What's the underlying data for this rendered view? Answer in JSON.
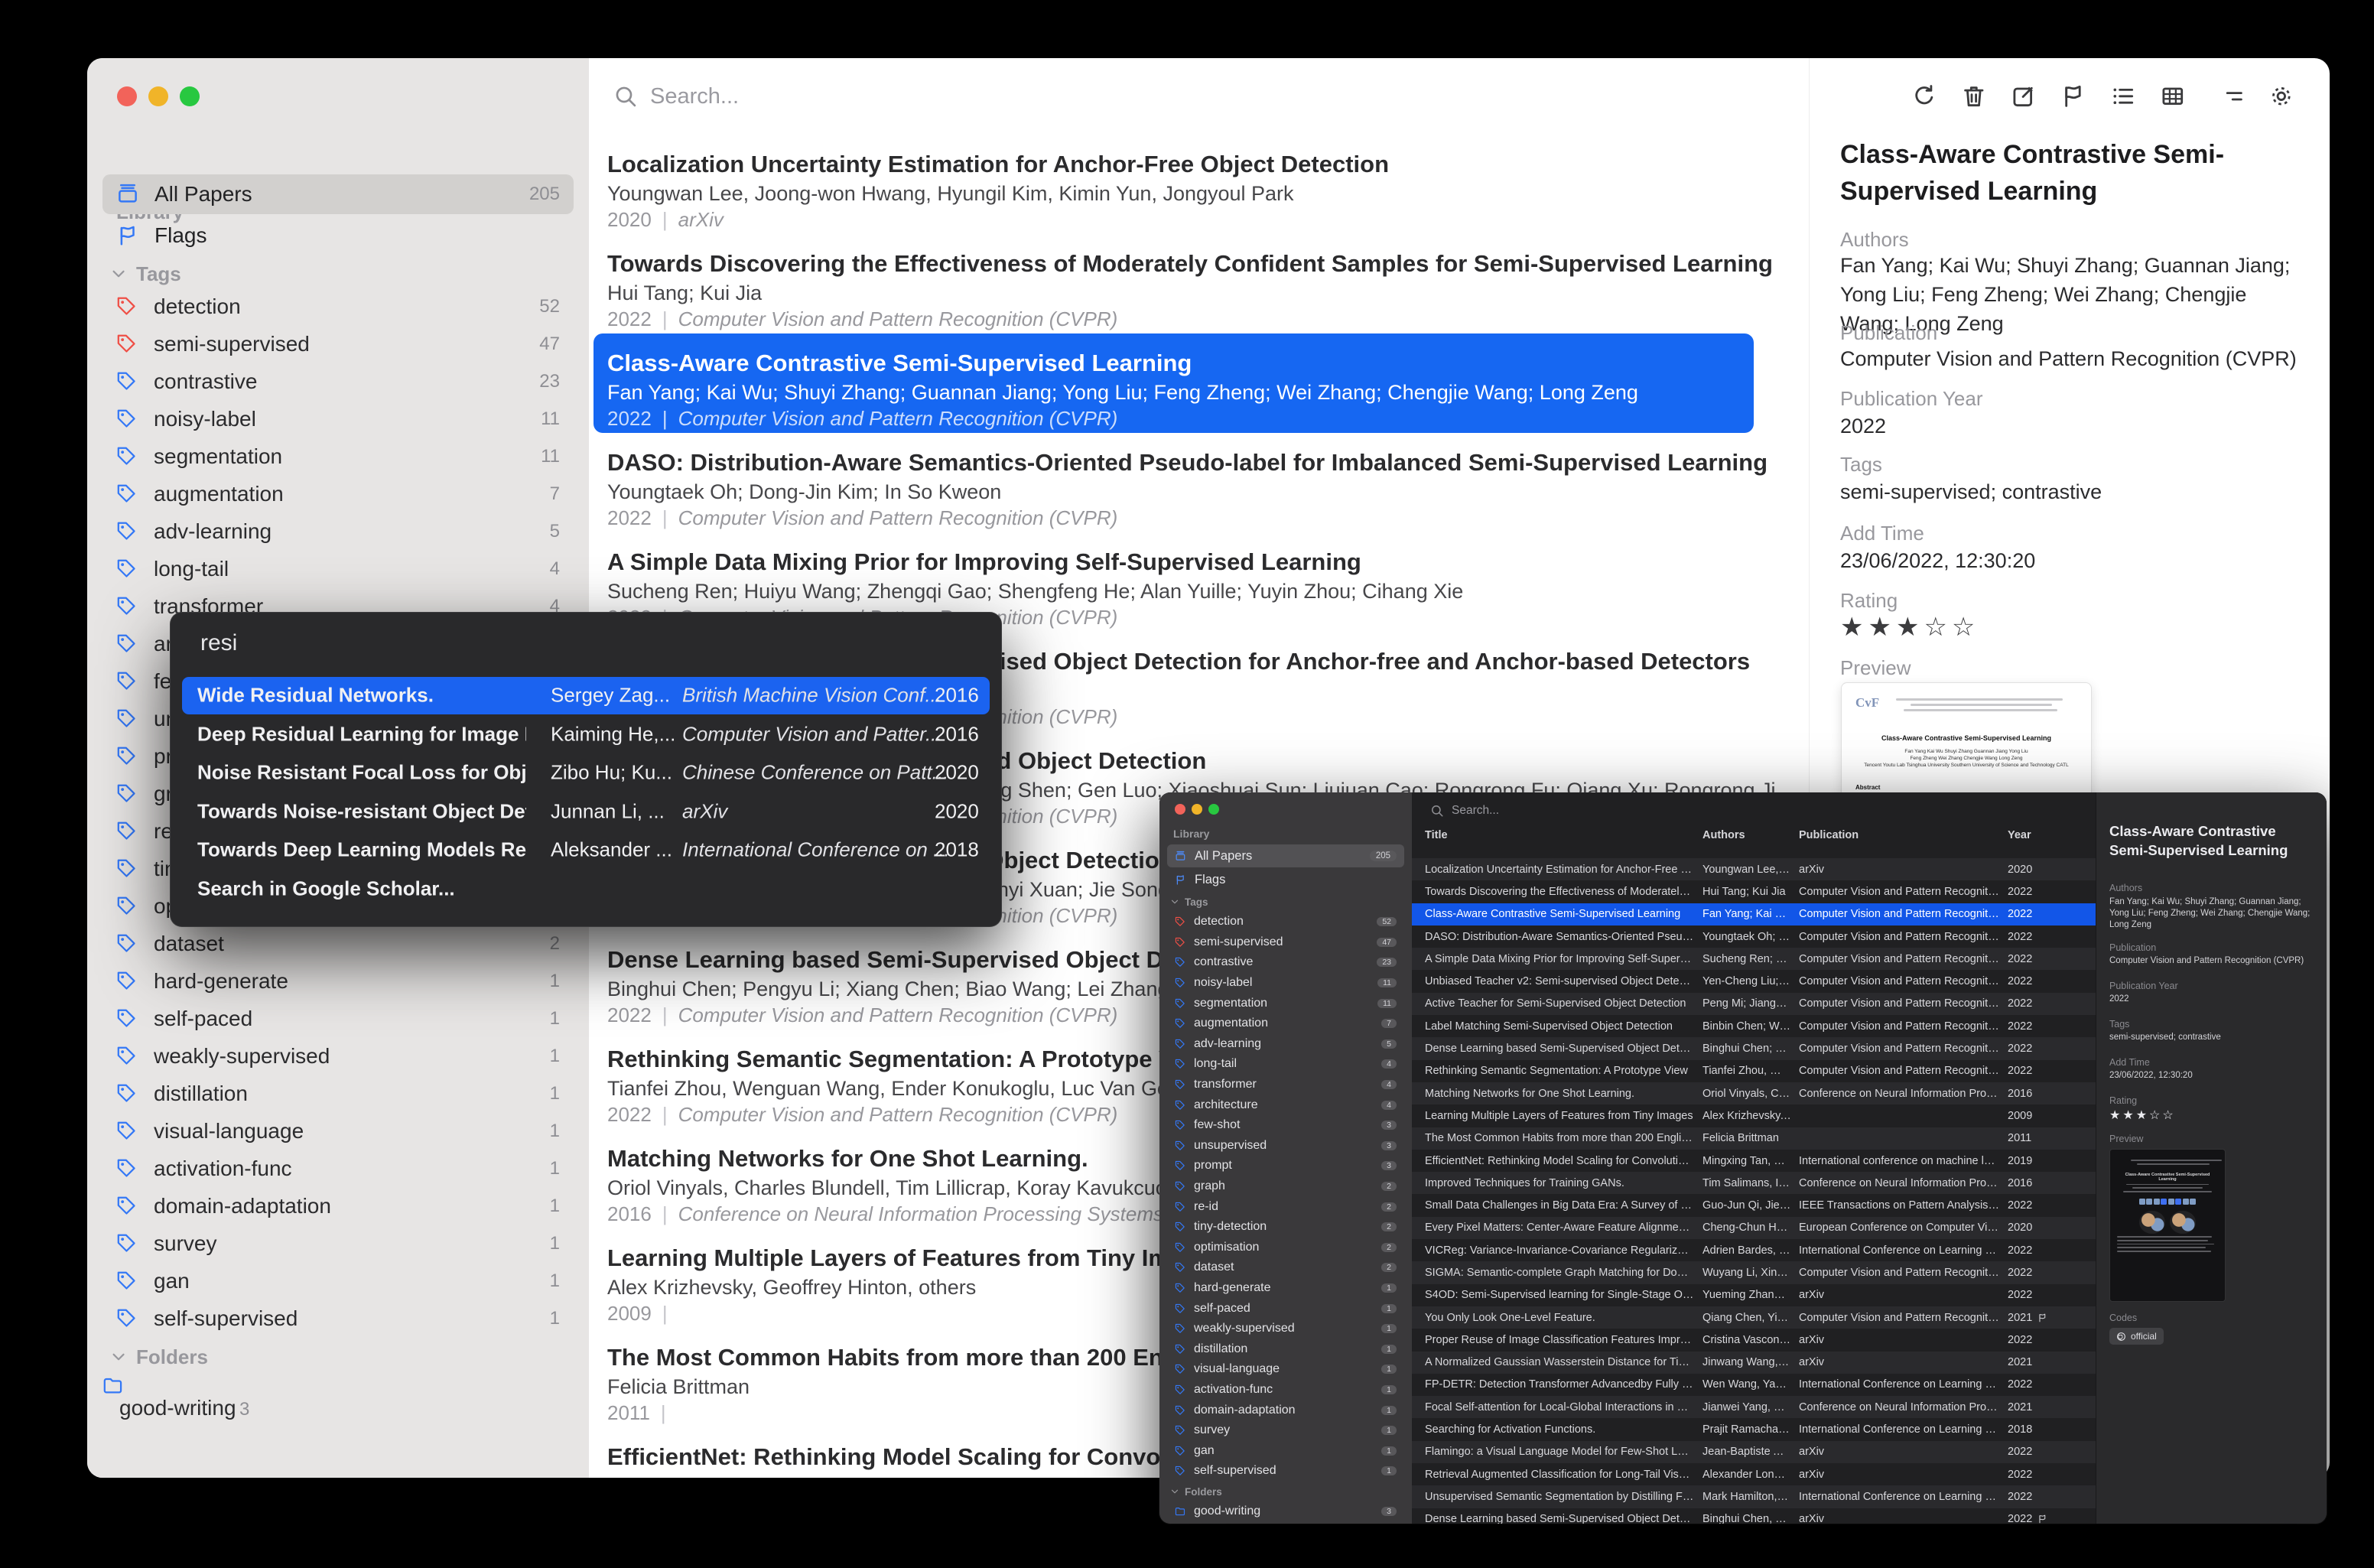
{
  "ui": {
    "pipe": "|"
  },
  "library": {
    "library_label": "Library",
    "all_papers": {
      "label": "All Papers",
      "count": "205"
    },
    "flags_label": "Flags",
    "tags_label": "Tags",
    "folders_label": "Folders",
    "tags": [
      {
        "label": "detection",
        "count": "52",
        "color": "#ef4f46"
      },
      {
        "label": "semi-supervised",
        "count": "47",
        "color": "#ef4f46"
      },
      {
        "label": "contrastive",
        "count": "23",
        "color": "#3478f6"
      },
      {
        "label": "noisy-label",
        "count": "11",
        "color": "#3478f6"
      },
      {
        "label": "segmentation",
        "count": "11",
        "color": "#3478f6"
      },
      {
        "label": "augmentation",
        "count": "7",
        "color": "#3478f6"
      },
      {
        "label": "adv-learning",
        "count": "5",
        "color": "#3478f6"
      },
      {
        "label": "long-tail",
        "count": "4",
        "color": "#3478f6"
      },
      {
        "label": "transformer",
        "count": "4",
        "color": "#3478f6"
      },
      {
        "label": "architecture",
        "count": "4",
        "color": "#3478f6"
      },
      {
        "label": "few-shot",
        "count": "3",
        "color": "#3478f6"
      },
      {
        "label": "unsupervised",
        "count": "3",
        "color": "#3478f6"
      },
      {
        "label": "prompt",
        "count": "3",
        "color": "#3478f6"
      },
      {
        "label": "graph",
        "count": "2",
        "color": "#3478f6"
      },
      {
        "label": "re-id",
        "count": "2",
        "color": "#3478f6"
      },
      {
        "label": "tiny-detection",
        "count": "2",
        "color": "#3478f6"
      },
      {
        "label": "optimisation",
        "count": "2",
        "color": "#3478f6"
      },
      {
        "label": "dataset",
        "count": "2",
        "color": "#3478f6"
      },
      {
        "label": "hard-generate",
        "count": "1",
        "color": "#3478f6"
      },
      {
        "label": "self-paced",
        "count": "1",
        "color": "#3478f6"
      },
      {
        "label": "weakly-supervised",
        "count": "1",
        "color": "#3478f6"
      },
      {
        "label": "distillation",
        "count": "1",
        "color": "#3478f6"
      },
      {
        "label": "visual-language",
        "count": "1",
        "color": "#3478f6"
      },
      {
        "label": "activation-func",
        "count": "1",
        "color": "#3478f6"
      },
      {
        "label": "domain-adaptation",
        "count": "1",
        "color": "#3478f6"
      },
      {
        "label": "survey",
        "count": "1",
        "color": "#3478f6"
      },
      {
        "label": "gan",
        "count": "1",
        "color": "#3478f6"
      },
      {
        "label": "self-supervised",
        "count": "1",
        "color": "#3478f6"
      }
    ],
    "folders": [
      {
        "label": "good-writing",
        "count": "3",
        "color": "#3478f6"
      }
    ]
  },
  "search": {
    "placeholder": "Search..."
  },
  "toolbar_icons": [
    "refresh",
    "trash",
    "edit",
    "flag",
    "list-view",
    "table-view",
    "filter",
    "settings"
  ],
  "main_window": {
    "papers": [
      {
        "title": "Localization Uncertainty Estimation for Anchor-Free Object Detection",
        "authors": "Youngwan Lee, Joong-won Hwang, Hyungil Kim, Kimin Yun, Jongyoul Park",
        "year": "2020",
        "publication": "arXiv"
      },
      {
        "title": "Towards Discovering the Effectiveness of Moderately Confident Samples for Semi-Supervised Learning",
        "authors": "Hui Tang; Kui Jia",
        "year": "2022",
        "publication": "Computer Vision and Pattern Recognition (CVPR)"
      },
      {
        "title": "Class-Aware Contrastive Semi-Supervised Learning",
        "authors": "Fan Yang; Kai Wu; Shuyi Zhang; Guannan Jiang; Yong Liu; Feng Zheng; Wei Zhang; Chengjie Wang; Long Zeng",
        "year": "2022",
        "publication": "Computer Vision and Pattern Recognition (CVPR)",
        "selected": true
      },
      {
        "title": "DASO: Distribution-Aware Semantics-Oriented Pseudo-label for Imbalanced Semi-Supervised Learning",
        "authors": "Youngtaek Oh; Dong-Jin Kim; In So Kweon",
        "year": "2022",
        "publication": "Computer Vision and Pattern Recognition (CVPR)"
      },
      {
        "title": "A Simple Data Mixing Prior for Improving Self-Supervised Learning",
        "authors": "Sucheng Ren; Huiyu Wang; Zhengqi Gao; Shengfeng He; Alan Yuille; Yuyin Zhou; Cihang Xie",
        "year": "2022",
        "publication": "Computer Vision and Pattern Recognition (CVPR)"
      },
      {
        "title": "Unbiased Teacher v2: Semi-supervised Object Detection for Anchor-free and Anchor-based Detectors",
        "authors": "Yen-Cheng Liu; Chih-Yao Ma; Zsolt Kira",
        "year": "2022",
        "publication": "Computer Vision and Pattern Recognition (CVPR)"
      },
      {
        "title": "Active Teacher for Semi-Supervised Object Detection",
        "authors": "Peng Mi; Jianghang Lin; Yiyi Zhou; Yunhang Shen; Gen Luo; Xiaoshuai Sun; Liujuan Cao; Rongrong Fu; Qiang Xu; Rongrong Ji",
        "year": "2022",
        "publication": "Computer Vision and Pattern Recognition (CVPR)"
      },
      {
        "title": "Label Matching Semi-Supervised Object Detection",
        "authors": "Binbin Chen; Weijie Chen; Shicai Yang; Yunyi Xuan; Jie Song; Di Xie",
        "year": "2022",
        "publication": "Computer Vision and Pattern Recognition (CVPR)"
      },
      {
        "title": "Dense Learning based Semi-Supervised Object Detection",
        "authors": "Binghui Chen; Pengyu Li; Xiang Chen; Biao Wang; Lei Zhang; Xian-Sheng Hua",
        "year": "2022",
        "publication": "Computer Vision and Pattern Recognition (CVPR)"
      },
      {
        "title": "Rethinking Semantic Segmentation: A Prototype View",
        "authors": "Tianfei Zhou, Wenguan Wang, Ender Konukoglu, Luc Van Gool",
        "year": "2022",
        "publication": "Computer Vision and Pattern Recognition (CVPR)"
      },
      {
        "title": "Matching Networks for One Shot Learning.",
        "authors": "Oriol Vinyals, Charles Blundell, Tim Lillicrap, Koray Kavukcuoglu, Daan Wierstra",
        "year": "2016",
        "publication": "Conference on Neural Information Processing Systems (NeurIPS)"
      },
      {
        "title": "Learning Multiple Layers of Features from Tiny Images",
        "authors": "Alex Krizhevsky, Geoffrey Hinton, others",
        "year": "2009",
        "publication": ""
      },
      {
        "title": "The Most Common Habits from more than 200 English Papers",
        "authors": "Felicia Brittman",
        "year": "2011",
        "publication": ""
      },
      {
        "title": "EfficientNet: Rethinking Model Scaling for Convolutional Neural Networks",
        "authors": "Mingxing Tan, Quoc Le",
        "year": "2019",
        "publication": "International conference on machine learning"
      }
    ],
    "detail": {
      "title": "Class-Aware Contrastive Semi-Supervised Learning",
      "authors_label": "Authors",
      "authors": "Fan Yang; Kai Wu; Shuyi Zhang; Guannan Jiang; Yong Liu; Feng Zheng; Wei Zhang; Chengjie Wang; Long Zeng",
      "publication_label": "Publication",
      "publication": "Computer Vision and Pattern Recognition (CVPR)",
      "publication_year_label": "Publication Year",
      "publication_year": "2022",
      "tags_label": "Tags",
      "tags": "semi-supervised; contrastive",
      "add_time_label": "Add Time",
      "add_time": "23/06/2022, 12:30:20",
      "rating_label": "Rating",
      "rating": 3,
      "rating_max": 5,
      "preview_label": "Preview",
      "preview": {
        "logo": "CvF",
        "title": "Class-Aware Contrastive Semi-Supervised Learning",
        "authors_line1": "Fan Yang   Kai Wu   Shuyi Zhang   Guannan Jiang   Yong Liu",
        "authors_line2": "Feng Zheng   Wei Zhang   Chengjie Wang   Long Zeng",
        "affiliation": "Tencent Youtu Lab   Tsinghua University   Southern University of Science and Technology   CATL",
        "abstract_label": "Abstract"
      }
    }
  },
  "search_popup": {
    "query": "resi",
    "results": [
      {
        "title": "Wide Residual Networks.",
        "authors": "Sergey Zag...",
        "publication": "British Machine Vision Conf...",
        "year": "2016",
        "selected": true
      },
      {
        "title": "Deep Residual Learning for Image Reco...",
        "authors": "Kaiming He,...",
        "publication": "Computer Vision and Patter...",
        "year": "2016"
      },
      {
        "title": "Noise Resistant Focal Loss for Object D...",
        "authors": "Zibo Hu; Ku...",
        "publication": "Chinese Conference on Patt...",
        "year": "2020"
      },
      {
        "title": "Towards Noise-resistant Object Detecti...",
        "authors": "Junnan Li, ...",
        "publication": "arXiv",
        "year": "2020"
      },
      {
        "title": "Towards Deep Learning Models Resista...",
        "authors": "Aleksander ...",
        "publication": "International Conference on ...",
        "year": "2018"
      }
    ],
    "footer": "Search in Google Scholar..."
  },
  "small_window": {
    "columns": {
      "title": "Title",
      "authors": "Authors",
      "publication": "Publication",
      "year": "Year"
    },
    "rows": [
      {
        "title": "Localization Uncertainty Estimation for Anchor-Free Obj...",
        "authors": "Youngwan Lee, J...",
        "publication": "arXiv",
        "year": "2020"
      },
      {
        "title": "Towards Discovering the Effectiveness of Moderately Co...",
        "authors": "Hui Tang; Kui Jia",
        "publication": "Computer Vision and Pattern Recognitio...",
        "year": "2022"
      },
      {
        "title": "Class-Aware Contrastive Semi-Supervised Learning",
        "authors": "Fan Yang; Kai Wu...",
        "publication": "Computer Vision and Pattern Recognitio...",
        "year": "2022",
        "selected": true
      },
      {
        "title": "DASO: Distribution-Aware Semantics-Oriented Pseudo-l...",
        "authors": "Youngtaek Oh; D...",
        "publication": "Computer Vision and Pattern Recognitio...",
        "year": "2022"
      },
      {
        "title": "A Simple Data Mixing Prior for Improving Self-Supervise...",
        "authors": "Sucheng Ren; Hui...",
        "publication": "Computer Vision and Pattern Recognitio...",
        "year": "2022"
      },
      {
        "title": "Unbiased Teacher v2: Semi-supervised Object Detection...",
        "authors": "Yen-Cheng Liu; C...",
        "publication": "Computer Vision and Pattern Recognitio...",
        "year": "2022"
      },
      {
        "title": "Active Teacher for Semi-Supervised Object Detection",
        "authors": "Peng Mi; Jiangha...",
        "publication": "Computer Vision and Pattern Recognitio...",
        "year": "2022"
      },
      {
        "title": "Label Matching Semi-Supervised Object Detection",
        "authors": "Binbin Chen; Weij...",
        "publication": "Computer Vision and Pattern Recognitio...",
        "year": "2022"
      },
      {
        "title": "Dense Learning based Semi-Supervised Object Detection",
        "authors": "Binghui Chen; Pe...",
        "publication": "Computer Vision and Pattern Recognitio...",
        "year": "2022"
      },
      {
        "title": "Rethinking Semantic Segmentation: A Prototype View",
        "authors": "Tianfei Zhou, We...",
        "publication": "Computer Vision and Pattern Recognitio...",
        "year": "2022"
      },
      {
        "title": "Matching Networks for One Shot Learning.",
        "authors": "Oriol Vinyals, Cha...",
        "publication": "Conference on Neural Information Proce...",
        "year": "2016"
      },
      {
        "title": "Learning Multiple Layers of Features from Tiny Images",
        "authors": "Alex Krizhevsky, ...",
        "publication": "",
        "year": "2009"
      },
      {
        "title": "The Most Common Habits from more than 200 English P...",
        "authors": "Felicia Brittman",
        "publication": "",
        "year": "2011"
      },
      {
        "title": "EfficientNet: Rethinking Model Scaling for Convolutional ...",
        "authors": "Mingxing Tan, Qu...",
        "publication": "International conference on machine lear...",
        "year": "2019"
      },
      {
        "title": "Improved Techniques for Training GANs.",
        "authors": "Tim Salimans, Ian...",
        "publication": "Conference on Neural Information Proce...",
        "year": "2016"
      },
      {
        "title": "Small Data Challenges in Big Data Era: A Survey of Rece...",
        "authors": "Guo-Jun Qi, Jieb...",
        "publication": "IEEE Transactions on Pattern Analysis an...",
        "year": "2022"
      },
      {
        "title": "Every Pixel Matters: Center-Aware Feature Alignment for...",
        "authors": "Cheng-Chun Hsu...",
        "publication": "European Conference on Computer Visio...",
        "year": "2020"
      },
      {
        "title": "VICReg: Variance-Invariance-Covariance Regularization f...",
        "authors": "Adrien Bardes, Je...",
        "publication": "International Conference on Learning Re...",
        "year": "2022"
      },
      {
        "title": "SIGMA: Semantic-complete Graph Matching for Domain ...",
        "authors": "Wuyang Li, Xinyu ...",
        "publication": "Computer Vision and Pattern Recognitio...",
        "year": "2022"
      },
      {
        "title": "S4OD: Semi-Supervised learning for Single-Stage Objec...",
        "authors": "Yueming Zhang, ...",
        "publication": "arXiv",
        "year": "2022"
      },
      {
        "title": "You Only Look One-Level Feature.",
        "authors": "Qiang Chen, Ying...",
        "publication": "Computer Vision and Pattern Recognitio...",
        "year": "2021",
        "flagged": true
      },
      {
        "title": "Proper Reuse of Image Classification Features Improves ...",
        "authors": "Cristina Vasconc...",
        "publication": "arXiv",
        "year": "2022"
      },
      {
        "title": "A Normalized Gaussian Wasserstein Distance for Tiny O...",
        "authors": "Jinwang Wang, C...",
        "publication": "arXiv",
        "year": "2021"
      },
      {
        "title": "FP-DETR: Detection Transformer Advancedby Fully Pre-t...",
        "authors": "Wen Wang, Yang ...",
        "publication": "International Conference on Learning Re...",
        "year": "2022"
      },
      {
        "title": "Focal Self-attention for Local-Global Interactions in Visio...",
        "authors": "Jianwei Yang, Ch...",
        "publication": "Conference on Neural Information Proce...",
        "year": "2021"
      },
      {
        "title": "Searching for Activation Functions.",
        "authors": "Prajit Ramachand...",
        "publication": "International Conference on Learning Re...",
        "year": "2018"
      },
      {
        "title": "Flamingo: a Visual Language Model for Few-Shot Learning",
        "authors": "Jean-Baptiste Ala...",
        "publication": "arXiv",
        "year": "2022"
      },
      {
        "title": "Retrieval Augmented Classification for Long-Tail Visual R...",
        "authors": "Alexander Long, ...",
        "publication": "arXiv",
        "year": "2022"
      },
      {
        "title": "Unsupervised Semantic Segmentation by Distilling Featu...",
        "authors": "Mark Hamilton, Z...",
        "publication": "International Conference on Learning Re...",
        "year": "2022"
      },
      {
        "title": "Dense Learning based Semi-Supervised Object Detection",
        "authors": "Binghui Chen, Pe...",
        "publication": "arXiv",
        "year": "2022",
        "flagged": true
      }
    ],
    "detail": {
      "title": "Class-Aware Contrastive Semi-Supervised Learning",
      "authors_label": "Authors",
      "authors": "Fan Yang; Kai Wu; Shuyi Zhang; Guannan Jiang; Yong Liu; Feng Zheng; Wei Zhang; Chengjie Wang; Long Zeng",
      "publication_label": "Publication",
      "publication": "Computer Vision and Pattern Recognition (CVPR)",
      "publication_year_label": "Publication Year",
      "publication_year": "2022",
      "tags_label": "Tags",
      "tags": "semi-supervised; contrastive",
      "add_time_label": "Add Time",
      "add_time": "23/06/2022, 12:30:20",
      "rating_label": "Rating",
      "rating": 3,
      "rating_max": 5,
      "preview_label": "Preview",
      "codes_label": "Codes",
      "code_badge": "official"
    }
  }
}
